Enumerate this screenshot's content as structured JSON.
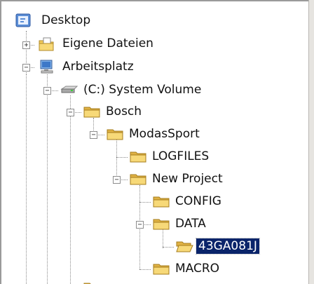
{
  "tree": {
    "items": [
      {
        "label": "Desktop",
        "icon": "desktop-icon",
        "expander": ""
      },
      {
        "label": "Eigene Dateien",
        "icon": "my-documents-icon",
        "expander": "+"
      },
      {
        "label": "Arbeitsplatz",
        "icon": "my-computer-icon",
        "expander": "−"
      },
      {
        "label": "(C:) System Volume",
        "icon": "hard-drive-icon",
        "expander": "−"
      },
      {
        "label": "Bosch",
        "icon": "folder-icon",
        "expander": "−"
      },
      {
        "label": "ModasSport",
        "icon": "folder-icon",
        "expander": "−"
      },
      {
        "label": "LOGFILES",
        "icon": "folder-icon",
        "expander": ""
      },
      {
        "label": "New Project",
        "icon": "folder-icon",
        "expander": "−"
      },
      {
        "label": "CONFIG",
        "icon": "folder-icon",
        "expander": ""
      },
      {
        "label": "DATA",
        "icon": "folder-icon",
        "expander": "−"
      },
      {
        "label": "43GA081J",
        "icon": "open-folder-icon",
        "expander": ""
      },
      {
        "label": "MACRO",
        "icon": "folder-icon",
        "expander": ""
      }
    ],
    "selected_label": "43GA081J"
  },
  "colors": {
    "selection": "#0a246a",
    "folder": "#f2cc5c"
  }
}
